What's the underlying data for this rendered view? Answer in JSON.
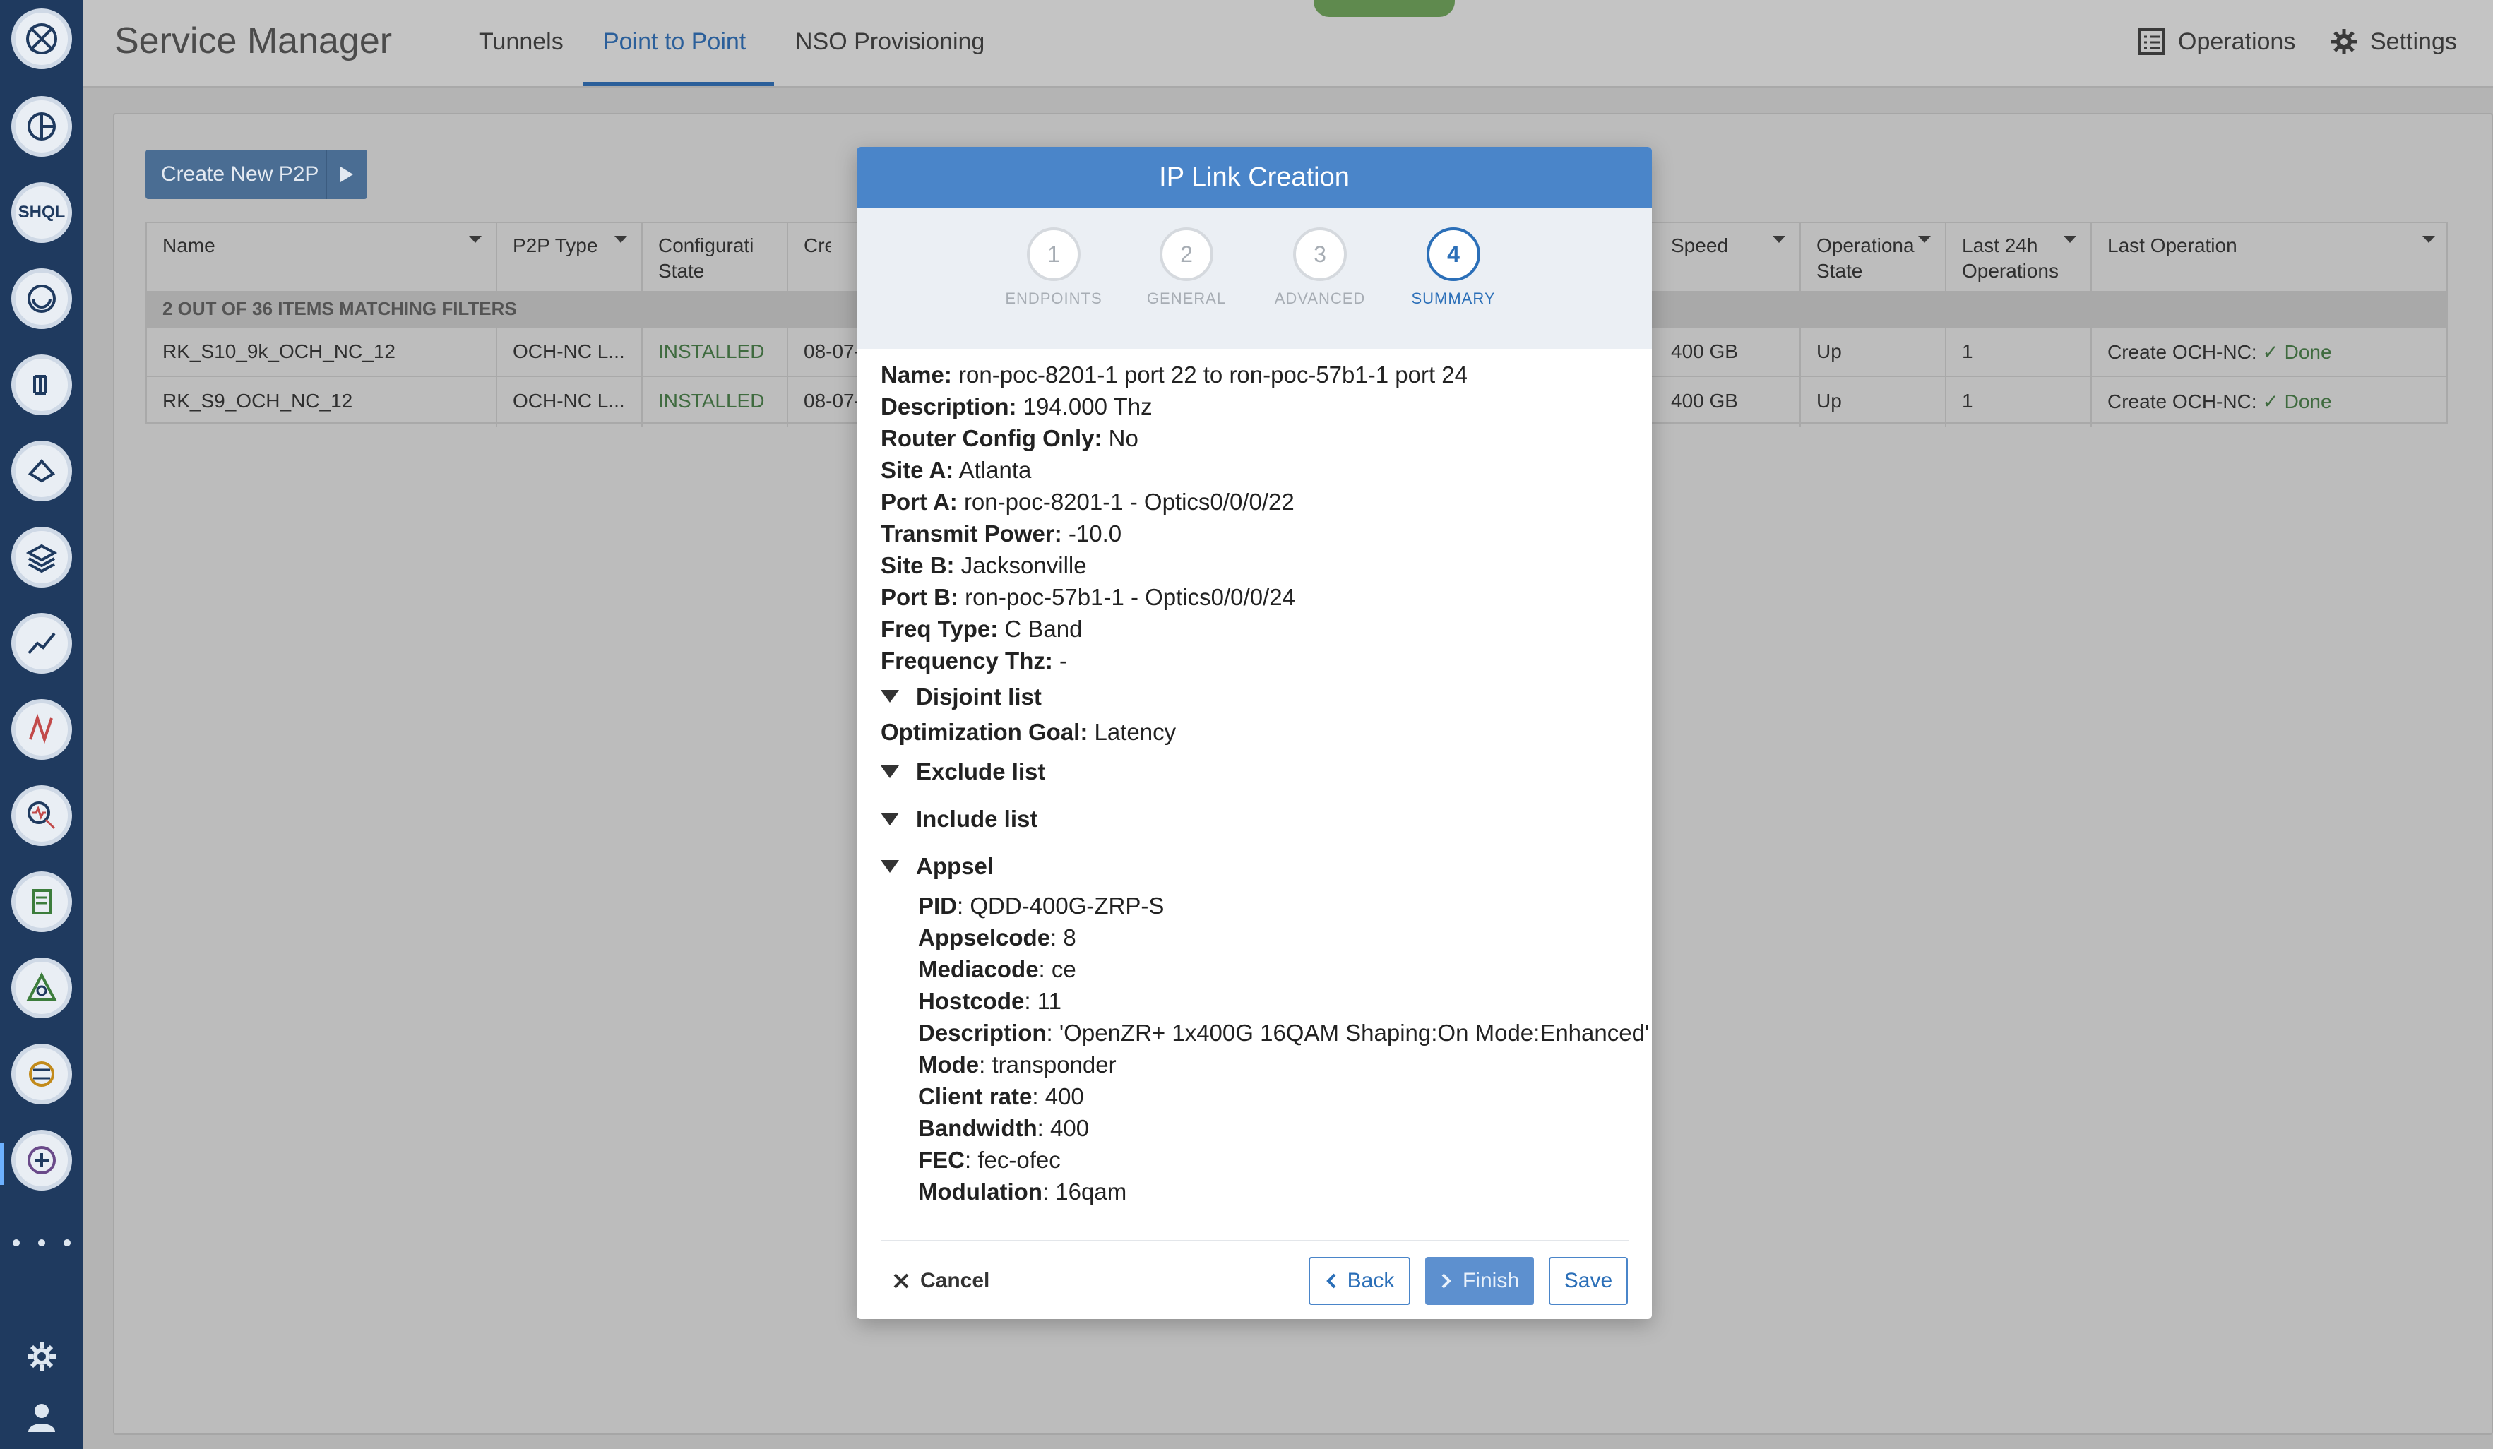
{
  "header": {
    "app_title": "Service Manager",
    "tabs": [
      "Tunnels",
      "Point to Point",
      "NSO Provisioning"
    ],
    "active_tab": "Point to Point",
    "operations_label": "Operations",
    "settings_label": "Settings"
  },
  "rail": {
    "icons": [
      "globe-icon",
      "network-icon",
      "shql-icon",
      "timeline-icon",
      "device-icon",
      "topology-icon",
      "layers-icon",
      "trend-icon",
      "analytics-icon",
      "health-icon",
      "report-icon",
      "triangle-icon",
      "tunnel-icon",
      "service-manager-icon",
      "more-icon",
      "gear-icon",
      "user-icon"
    ],
    "shql_label": "SHQL"
  },
  "toolbar": {
    "create_label": "Create New P2P"
  },
  "table": {
    "columns": [
      "Name",
      "P2P Type",
      "Configurati\nState",
      "Crea",
      "Speed",
      "Operationa\nState",
      "Last 24h\nOperations",
      "Last Operation"
    ],
    "filter_text": "2 OUT OF 36 ITEMS MATCHING FILTERS",
    "rows": [
      {
        "name": "RK_S10_9k_OCH_NC_12",
        "type": "OCH-NC L...",
        "state": "INSTALLED",
        "created": "08-07-",
        "speed": "400 GB",
        "op_state": "Up",
        "ops": "1",
        "last_op": "Create OCH-NC:",
        "status": "✓ Done"
      },
      {
        "name": "RK_S9_OCH_NC_12",
        "type": "OCH-NC L...",
        "state": "INSTALLED",
        "created": "08-07-",
        "speed": "400 GB",
        "op_state": "Up",
        "ops": "1",
        "last_op": "Create OCH-NC:",
        "status": "✓ Done"
      }
    ]
  },
  "dialog": {
    "title": "IP Link Creation",
    "steps": [
      {
        "num": "1",
        "label": "ENDPOINTS"
      },
      {
        "num": "2",
        "label": "GENERAL"
      },
      {
        "num": "3",
        "label": "ADVANCED"
      },
      {
        "num": "4",
        "label": "SUMMARY"
      }
    ],
    "active_step": 4,
    "fields": [
      {
        "k": "Name:",
        "v": "ron-poc-8201-1 port 22 to ron-poc-57b1-1 port 24"
      },
      {
        "k": "Description:",
        "v": "194.000 Thz"
      },
      {
        "k": "Router Config Only:",
        "v": "No"
      },
      {
        "k": "Site A:",
        "v": "Atlanta"
      },
      {
        "k": "Port A:",
        "v": "ron-poc-8201-1 - Optics0/0/0/22"
      },
      {
        "k": "Transmit Power:",
        "v": "-10.0"
      },
      {
        "k": "Site B:",
        "v": "Jacksonville"
      },
      {
        "k": "Port B:",
        "v": "ron-poc-57b1-1 - Optics0/0/0/24"
      },
      {
        "k": "Freq Type:",
        "v": "C Band"
      },
      {
        "k": "Frequency Thz:",
        "v": "-"
      }
    ],
    "disjoint_label": "Disjoint list",
    "opt_goal": {
      "k": "Optimization Goal:",
      "v": "Latency"
    },
    "exclude_label": "Exclude list",
    "include_label": "Include list",
    "appsel_label": "Appsel",
    "appsel": [
      {
        "k": "PID",
        "v": ": QDD-400G-ZRP-S"
      },
      {
        "k": "Appselcode",
        "v": ": 8"
      },
      {
        "k": "Mediacode",
        "v": ": ce"
      },
      {
        "k": "Hostcode",
        "v": ": 11"
      },
      {
        "k": "Description",
        "v": ": 'OpenZR+ 1x400G 16QAM Shaping:On Mode:Enhanced'"
      },
      {
        "k": "Mode",
        "v": ": transponder"
      },
      {
        "k": "Client rate",
        "v": ": 400"
      },
      {
        "k": "Bandwidth",
        "v": ": 400"
      },
      {
        "k": "FEC",
        "v": ": fec-ofec"
      },
      {
        "k": "Modulation",
        "v": ": 16qam"
      }
    ],
    "buttons": {
      "cancel": "Cancel",
      "back": "Back",
      "finish": "Finish",
      "save": "Save"
    }
  }
}
